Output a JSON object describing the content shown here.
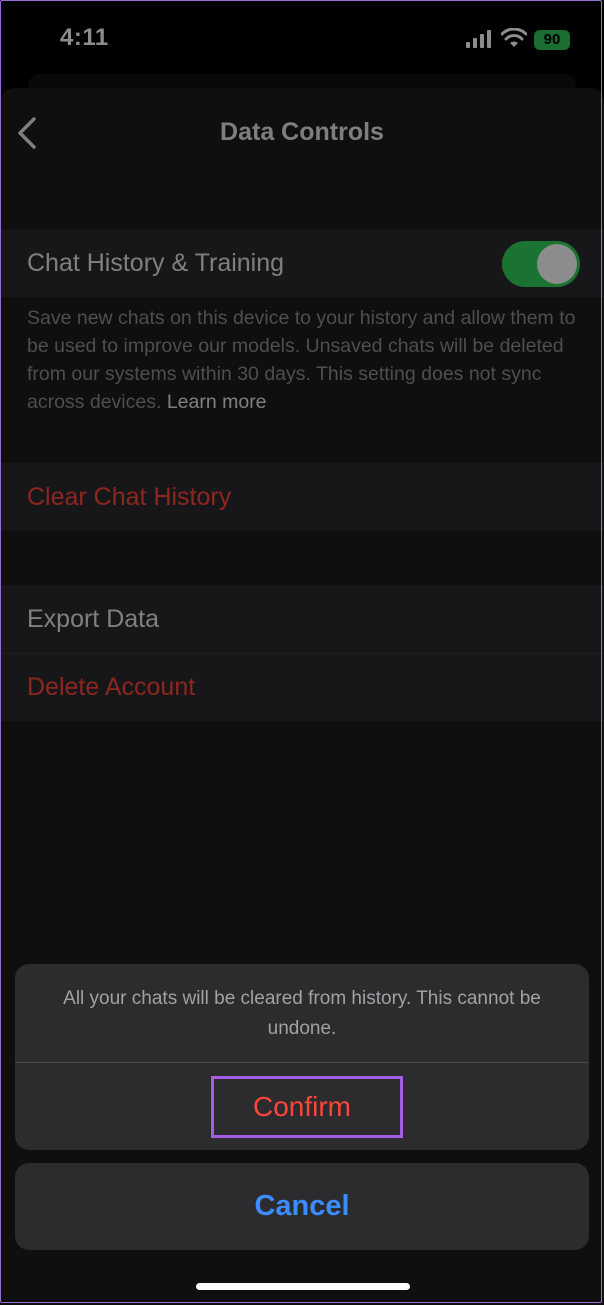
{
  "status_bar": {
    "time": "4:11",
    "battery": "90"
  },
  "nav": {
    "title": "Data Controls"
  },
  "settings": {
    "chat_history_label": "Chat History & Training",
    "chat_history_enabled": true,
    "description": "Save new chats on this device to your history and allow them to be used to improve our models. Unsaved chats will be deleted from our systems within 30 days. This setting does not sync across devices.",
    "learn_more": "Learn more",
    "clear_history_label": "Clear Chat History",
    "export_label": "Export Data",
    "delete_label": "Delete Account"
  },
  "action_sheet": {
    "message": "All your chats will be cleared from history. This cannot be undone.",
    "confirm_label": "Confirm",
    "cancel_label": "Cancel"
  },
  "colors": {
    "destructive": "#ff453a",
    "cancel_blue": "#3a8cff",
    "toggle_on": "#30d158",
    "highlight": "#a45ee5"
  }
}
